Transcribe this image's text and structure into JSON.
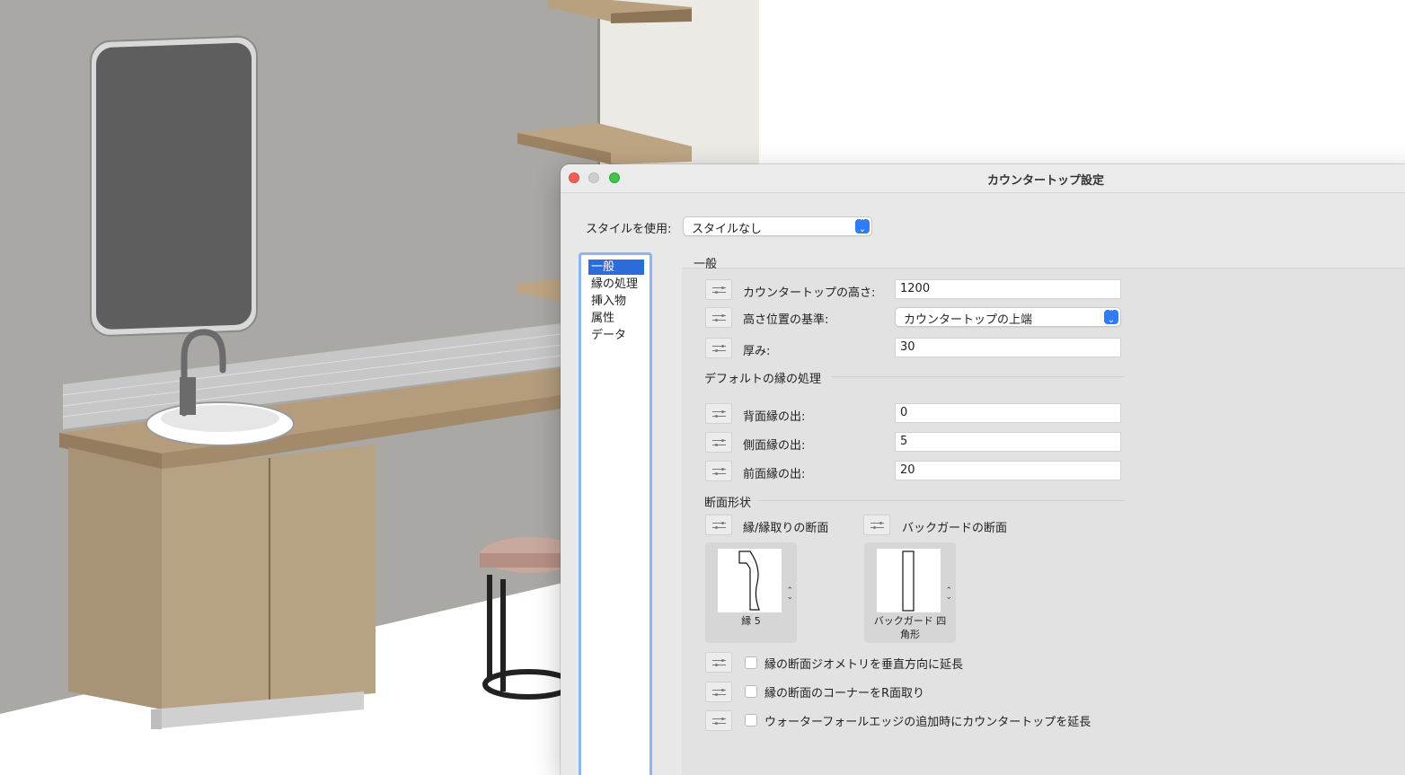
{
  "dialog": {
    "title": "カウンタートップ設定",
    "style_label": "スタイルを使用:",
    "style_value": "スタイルなし",
    "sidebar": [
      {
        "label": "一般",
        "selected": true
      },
      {
        "label": "縁の処理"
      },
      {
        "label": "挿入物"
      },
      {
        "label": "属性"
      },
      {
        "label": "データ"
      }
    ],
    "section_general": "一般",
    "height_label": "カウンタートップの高さ:",
    "height_value": "1200",
    "ref_label": "高さ位置の基準:",
    "ref_value": "カウンタートップの上端",
    "thickness_label": "厚み:",
    "thickness_value": "30",
    "default_edge_heading": "デフォルトの縁の処理",
    "back_label": "背面縁の出:",
    "back_value": "0",
    "side_label": "側面縁の出:",
    "side_value": "5",
    "front_label": "前面縁の出:",
    "front_value": "20",
    "profile_heading": "断面形状",
    "edge_profile_label": "縁/縁取りの断面",
    "backsplash_profile_label": "バックガードの断面",
    "edge_thumb_label": "縁 5",
    "backsplash_thumb_label": "バックガード 四\n角形",
    "check1_label": "縁の断面ジオメトリを垂直方向に延長",
    "check2_label": "縁の断面のコーナーをR面取り",
    "check3_label": "ウォーターフォールエッジの追加時にカウンタートップを延長",
    "checks": [
      false,
      false,
      false
    ]
  },
  "colors": {
    "accent": "#2f7cf6",
    "selection": "#2d6bd8",
    "close": "#ee5f57",
    "zoom": "#3fc54d"
  }
}
